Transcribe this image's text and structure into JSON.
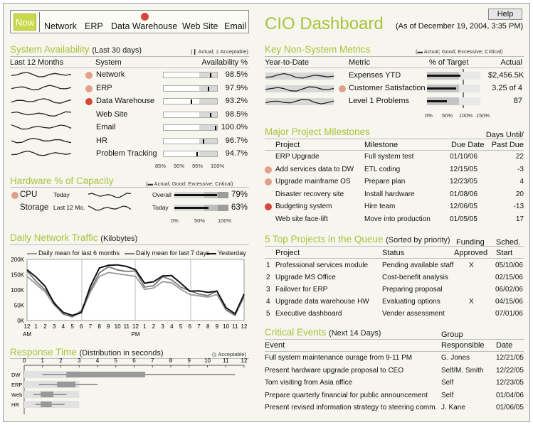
{
  "nav": {
    "now": "Now",
    "items": [
      "Network",
      "ERP",
      "Data Warehouse",
      "Web Site",
      "Email"
    ]
  },
  "header": {
    "title": "CIO Dashboard",
    "as_of": "(As of December 19, 2004, 3:35 PM)",
    "help": "Help"
  },
  "sysavail": {
    "title": "System Availability",
    "subtitle": "(Last 30 days)",
    "legend": [
      "Actual",
      "Acceptable"
    ],
    "headers": [
      "Last 12 Months",
      "System",
      "Availability %"
    ],
    "rows": [
      {
        "name": "Network",
        "value": "98.5%",
        "status": "warn",
        "actual": 0.985
      },
      {
        "name": "ERP",
        "value": "97.9%",
        "status": "warn",
        "actual": 0.979
      },
      {
        "name": "Data Warehouse",
        "value": "93.2%",
        "status": "critical",
        "actual": 0.932
      },
      {
        "name": "Web Site",
        "value": "98.5%",
        "status": "",
        "actual": 0.985
      },
      {
        "name": "Email",
        "value": "100.0%",
        "status": "",
        "actual": 1.0
      },
      {
        "name": "HR",
        "value": "96.7%",
        "status": "",
        "actual": 0.967
      },
      {
        "name": "Problem Tracking",
        "value": "94.7%",
        "status": "",
        "actual": 0.947
      }
    ],
    "axis": [
      "85%",
      "90%",
      "95%",
      "100%"
    ]
  },
  "hardware": {
    "title": "Hardware % of Capacity",
    "legend": [
      "Actual",
      "Good",
      "Excessive",
      "Critical"
    ],
    "rows": [
      {
        "name": "CPU",
        "period": "Today",
        "bar_label": "Overall",
        "value": "79%",
        "actual": 0.79
      },
      {
        "name": "Storage",
        "period": "Last 12 Mo.",
        "bar_label": "Today",
        "value": "63%",
        "actual": 0.63
      }
    ],
    "axis": [
      "0%",
      "50%",
      "100%"
    ]
  },
  "traffic": {
    "title": "Daily Network Traffic",
    "subtitle": "(Kilobytes)",
    "legend": [
      "Daily mean for last 6 months",
      "Daily mean for last 7 days",
      "Yesterday"
    ],
    "yticks": [
      "200K",
      "150K",
      "100K",
      "50K",
      "0K"
    ],
    "xticks": [
      "12",
      "1",
      "2",
      "3",
      "4",
      "5",
      "6",
      "7",
      "8",
      "9",
      "10",
      "11",
      "12",
      "1",
      "2",
      "3",
      "4",
      "5",
      "6",
      "7",
      "8",
      "9",
      "10",
      "11",
      "12"
    ],
    "am": "AM",
    "pm": "PM"
  },
  "response": {
    "title": "Response Time",
    "subtitle": "(Distribution in seconds)",
    "legend": "Acceptable",
    "axis": [
      "0",
      "1",
      "2",
      "3",
      "4",
      "5",
      "6",
      "7",
      "8",
      "9",
      "10",
      "11",
      "12"
    ],
    "rows": [
      "DW",
      "ERP",
      "Web",
      "HR"
    ]
  },
  "metrics": {
    "title": "Key Non-System Metrics",
    "legend": [
      "Actual",
      "Good",
      "Excessive",
      "Critical"
    ],
    "headers": [
      "Year-to-Date",
      "Metric",
      "% of Target",
      "Actual"
    ],
    "rows": [
      {
        "name": "Expenses YTD",
        "value": "$2,456.5K",
        "status": "",
        "actual": 0.93
      },
      {
        "name": "Customer Satisfaction",
        "value": "3.25 of 4",
        "status": "warn",
        "actual": 0.81
      },
      {
        "name": "Level 1 Problems",
        "value": "87",
        "status": "",
        "actual": 0.55
      }
    ],
    "axis": [
      "0%",
      "50%",
      "100%",
      "150%"
    ]
  },
  "milestones": {
    "title": "Major Project Milestones",
    "headers": [
      "Project",
      "Milestone",
      "Due Date",
      "Days Until/",
      "Past Due"
    ],
    "rows": [
      {
        "project": "ERP Upgrade",
        "milestone": "Full system test",
        "due": "01/10/06",
        "days": "22",
        "status": ""
      },
      {
        "project": "Add services data to DW",
        "milestone": "ETL coding",
        "due": "12/15/05",
        "days": "-3",
        "status": "warn"
      },
      {
        "project": "Upgrade mainframe OS",
        "milestone": "Prepare plan",
        "due": "12/23/05",
        "days": "4",
        "status": "warn"
      },
      {
        "project": "Disaster recovery site",
        "milestone": "Install hardware",
        "due": "01/08/06",
        "days": "20",
        "status": ""
      },
      {
        "project": "Budgeting system",
        "milestone": "Hire team",
        "due": "12/06/05",
        "days": "-13",
        "status": "critical"
      },
      {
        "project": "Web site face-lift",
        "milestone": "Move into production",
        "due": "01/05/05",
        "days": "17",
        "status": ""
      }
    ]
  },
  "queue": {
    "title": "5 Top Projects in the Queue",
    "subtitle": "(Sorted by priority)",
    "headers": [
      "Project",
      "Status",
      "Funding",
      "Approved",
      "Sched.",
      "Start"
    ],
    "rows": [
      {
        "n": "1",
        "project": "Professional services module",
        "status": "Pending available staff",
        "funded": "X",
        "start": "05/10/06"
      },
      {
        "n": "2",
        "project": "Upgrade MS Office",
        "status": "Cost-benefit analysis",
        "funded": "",
        "start": "02/15/06"
      },
      {
        "n": "3",
        "project": "Failover for ERP",
        "status": "Preparing proposal",
        "funded": "",
        "start": "06/02/06"
      },
      {
        "n": "4",
        "project": "Upgrade data warehouse HW",
        "status": "Evaluating options",
        "funded": "X",
        "start": "04/15/06"
      },
      {
        "n": "5",
        "project": "Executive dashboard",
        "status": "Vender assessment",
        "funded": "",
        "start": "07/01/06"
      }
    ]
  },
  "events": {
    "title": "Critical Events",
    "subtitle": "(Next 14 Days)",
    "headers": [
      "Event",
      "Group",
      "Responsible",
      "Date"
    ],
    "rows": [
      {
        "event": "Full system maintenance ourage from 9-11 PM",
        "group": "G. Jones",
        "date": "12/21/05"
      },
      {
        "event": "Present hardware upgrade proposal to CEO",
        "group": "Self/M. Smith",
        "date": "12/22/05"
      },
      {
        "event": "Tom visiting from Asia office",
        "group": "Self",
        "date": "12/23/05"
      },
      {
        "event": "Prepare quarterly financial for public announcement",
        "group": "Self",
        "date": "01/04/06"
      },
      {
        "event": "Present revised information strategy to steering comm.",
        "group": "J. Kane",
        "date": "01/06/05"
      }
    ]
  }
}
